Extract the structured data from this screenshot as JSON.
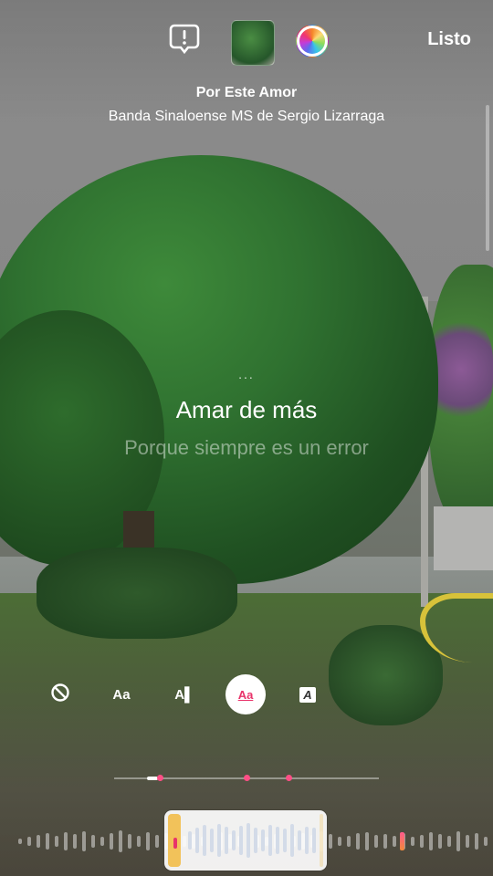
{
  "top_bar": {
    "report_icon": "alert-bubble-icon",
    "cover_icon": "album-cover-thumbnail",
    "color_icon": "color-wheel-icon",
    "done_label": "Listo"
  },
  "song": {
    "title": "Por Este Amor",
    "artist": "Banda Sinaloense MS de Sergio Lizarraga"
  },
  "lyrics": {
    "indicator": "...",
    "current": "Amar de más",
    "next": "Porque siempre es un error"
  },
  "styles": {
    "items": [
      {
        "name": "none",
        "label": "⦸"
      },
      {
        "name": "typewriter",
        "label": "Aa"
      },
      {
        "name": "cursor",
        "label": "A▌"
      },
      {
        "name": "underline",
        "label": "Aa",
        "selected": true
      },
      {
        "name": "boxed",
        "label": "A"
      }
    ]
  },
  "colors": {
    "accent": "#e8336a",
    "scrubber_edge": "#f2c25a"
  }
}
